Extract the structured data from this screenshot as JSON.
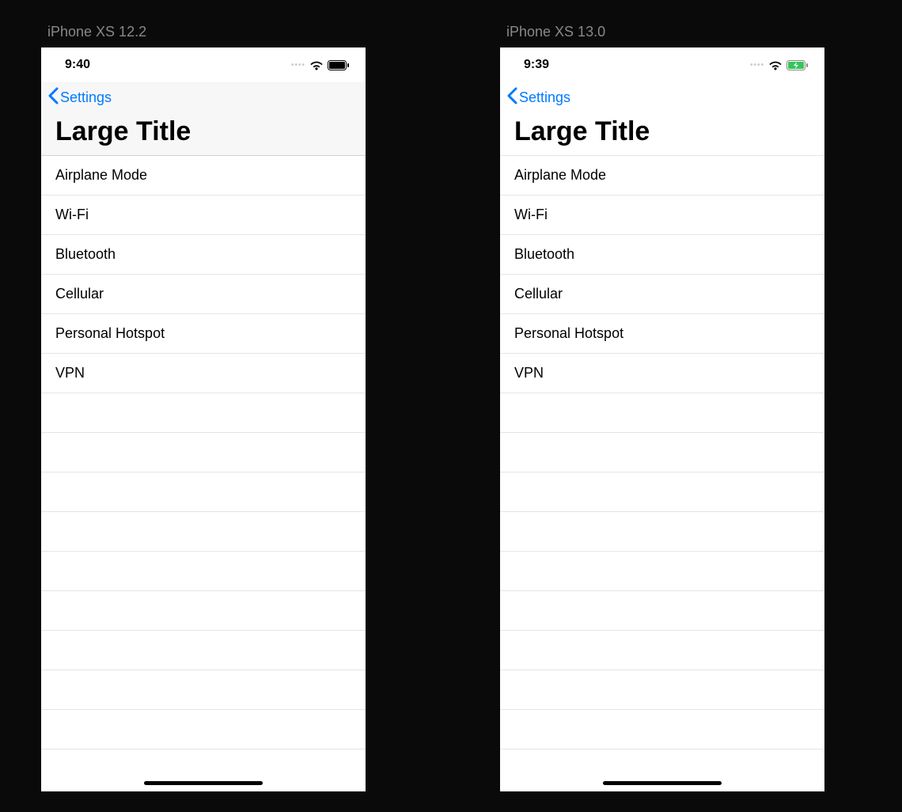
{
  "captions": {
    "left": "iPhone XS 12.2",
    "right": "iPhone XS 13.0"
  },
  "left": {
    "status": {
      "time": "9:40"
    },
    "nav": {
      "back_label": "Settings"
    },
    "title": "Large Title",
    "items": [
      {
        "label": "Airplane Mode"
      },
      {
        "label": "Wi-Fi"
      },
      {
        "label": "Bluetooth"
      },
      {
        "label": "Cellular"
      },
      {
        "label": "Personal Hotspot"
      },
      {
        "label": "VPN"
      }
    ],
    "battery_charging": false
  },
  "right": {
    "status": {
      "time": "9:39"
    },
    "nav": {
      "back_label": "Settings"
    },
    "title": "Large Title",
    "items": [
      {
        "label": "Airplane Mode"
      },
      {
        "label": "Wi-Fi"
      },
      {
        "label": "Bluetooth"
      },
      {
        "label": "Cellular"
      },
      {
        "label": "Personal Hotspot"
      },
      {
        "label": "VPN"
      }
    ],
    "battery_charging": true
  },
  "colors": {
    "accent": "#007aff",
    "battery_green": "#34c759"
  }
}
